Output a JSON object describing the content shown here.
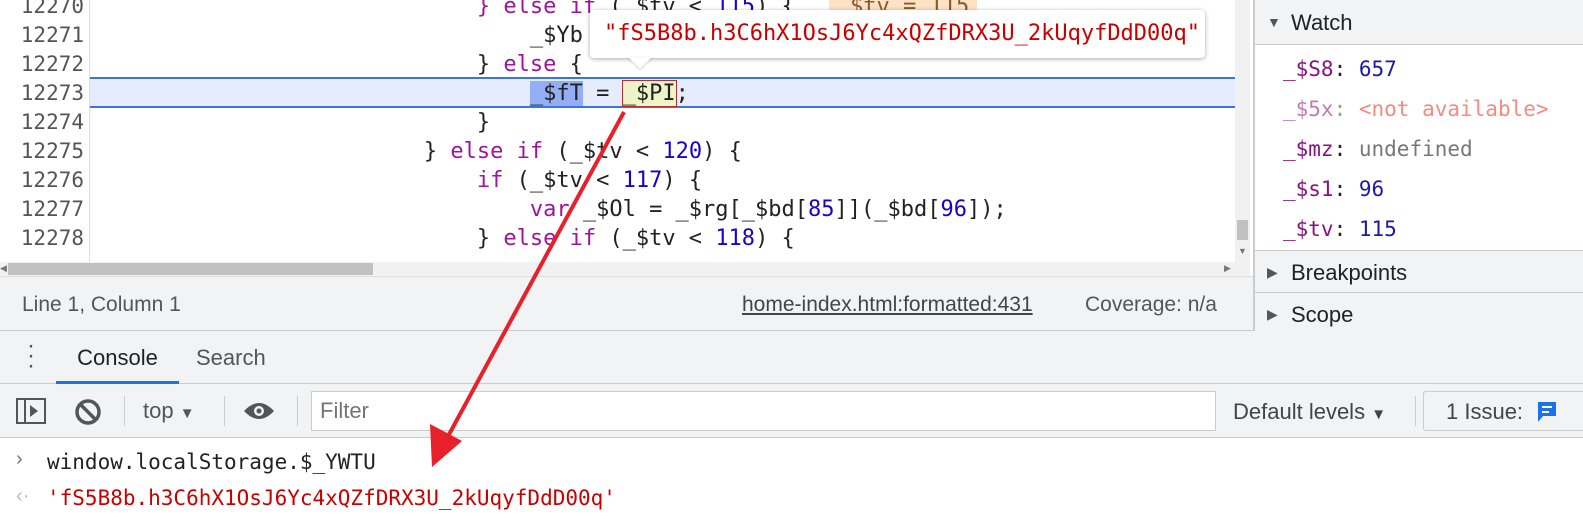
{
  "editor": {
    "lines": [
      {
        "n": "12270",
        "indent": "                            ",
        "parts": [
          [
            "kw",
            "} else if"
          ],
          [
            "var",
            " (_$tv < "
          ],
          [
            "num",
            "115"
          ],
          [
            "var",
            ") {"
          ]
        ],
        "inline": "_$tv = 115"
      },
      {
        "n": "12271",
        "indent": "                                ",
        "parts": [
          [
            "var",
            "_$Yb = "
          ]
        ]
      },
      {
        "n": "12272",
        "indent": "                            ",
        "parts": [
          [
            "var",
            "} "
          ],
          [
            "kw",
            "else"
          ],
          [
            "var",
            " {"
          ]
        ]
      },
      {
        "n": "12273",
        "indent": "                                ",
        "parts": [
          [
            "sel",
            "_$fT"
          ],
          [
            "var",
            " = "
          ],
          [
            "hov",
            "_$PI"
          ],
          [
            "var",
            ";"
          ]
        ]
      },
      {
        "n": "12274",
        "indent": "                            ",
        "parts": [
          [
            "var",
            "}"
          ]
        ]
      },
      {
        "n": "12275",
        "indent": "                        ",
        "parts": [
          [
            "var",
            "} "
          ],
          [
            "kw",
            "else if"
          ],
          [
            "var",
            " (_$tv < "
          ],
          [
            "num",
            "120"
          ],
          [
            "var",
            ") {"
          ]
        ]
      },
      {
        "n": "12276",
        "indent": "                            ",
        "parts": [
          [
            "kw",
            "if"
          ],
          [
            "var",
            " (_$tv < "
          ],
          [
            "num",
            "117"
          ],
          [
            "var",
            ") {"
          ]
        ]
      },
      {
        "n": "12277",
        "indent": "                                ",
        "parts": [
          [
            "kw",
            "var"
          ],
          [
            "var",
            " _$Ol = _$rg[_$bd["
          ],
          [
            "num",
            "85"
          ],
          [
            "var",
            "]](_$bd["
          ],
          [
            "num",
            "96"
          ],
          [
            "var",
            "]);"
          ]
        ]
      },
      {
        "n": "12278",
        "indent": "                            ",
        "parts": [
          [
            "var",
            "} "
          ],
          [
            "kw",
            "else if"
          ],
          [
            "var",
            " (_$tv < "
          ],
          [
            "num",
            "118"
          ],
          [
            "var",
            ") {"
          ]
        ]
      }
    ],
    "tooltip": "\"fS5B8b.h3C6hX1OsJ6Yc4xQZfDRX3U_2kUqyfDdD00q\""
  },
  "status": {
    "position": "Line 1, Column 1",
    "source_link": "home-index.html:formatted:431",
    "coverage": "Coverage: n/a"
  },
  "sidebar": {
    "watch_title": "Watch",
    "watch": [
      {
        "name": "_$S8",
        "value": "657",
        "type": "num"
      },
      {
        "name": "_$5x",
        "value": "<not available>",
        "type": "na"
      },
      {
        "name": "_$mz",
        "value": "undefined",
        "type": "undef"
      },
      {
        "name": "_$s1",
        "value": "96",
        "type": "num"
      },
      {
        "name": "_$tv",
        "value": "115",
        "type": "num"
      }
    ],
    "breakpoints_title": "Breakpoints",
    "scope_title": "Scope"
  },
  "drawer": {
    "tabs": [
      "Console",
      "Search"
    ],
    "active": "Console"
  },
  "toolbar": {
    "context": "top",
    "filter_placeholder": "Filter",
    "levels": "Default levels",
    "issues": "1 Issue:"
  },
  "console": {
    "input": "window.localStorage.$_YWTU",
    "result": "'fS5B8b.h3C6hX1OsJ6Yc4xQZfDRX3U_2kUqyfDdD00q'"
  },
  "colors": {
    "accent": "#1a73e8",
    "annotation_arrow": "#e8202a",
    "string": "#c80000"
  }
}
